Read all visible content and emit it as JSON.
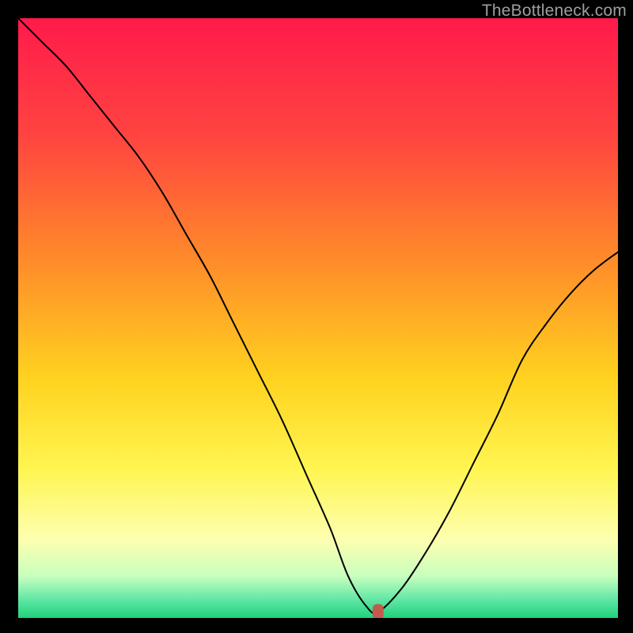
{
  "watermark": "TheBottleneck.com",
  "chart_data": {
    "type": "line",
    "title": "",
    "xlabel": "",
    "ylabel": "",
    "xlim": [
      0,
      100
    ],
    "ylim": [
      0,
      100
    ],
    "grid": false,
    "legend": false,
    "gradient_stops": [
      {
        "offset": 0.0,
        "color": "#ff1a4b"
      },
      {
        "offset": 0.2,
        "color": "#ff4540"
      },
      {
        "offset": 0.4,
        "color": "#ff8a2a"
      },
      {
        "offset": 0.6,
        "color": "#ffd21f"
      },
      {
        "offset": 0.75,
        "color": "#fff550"
      },
      {
        "offset": 0.87,
        "color": "#fdffb0"
      },
      {
        "offset": 0.93,
        "color": "#c8ffbe"
      },
      {
        "offset": 0.97,
        "color": "#5fe6a5"
      },
      {
        "offset": 1.0,
        "color": "#1fd27a"
      }
    ],
    "series": [
      {
        "name": "bottleneck-curve",
        "x": [
          0,
          4,
          8,
          12,
          16,
          20,
          24,
          28,
          32,
          36,
          40,
          44,
          48,
          52,
          55,
          58,
          60,
          64,
          68,
          72,
          76,
          80,
          84,
          88,
          92,
          96,
          100
        ],
        "y": [
          100,
          96,
          92,
          87,
          82,
          77,
          71,
          64,
          57,
          49,
          41,
          33,
          24,
          15,
          7,
          2,
          1,
          5,
          11,
          18,
          26,
          34,
          43,
          49,
          54,
          58,
          61
        ]
      }
    ],
    "marker": {
      "x": 60,
      "y": 1
    }
  }
}
